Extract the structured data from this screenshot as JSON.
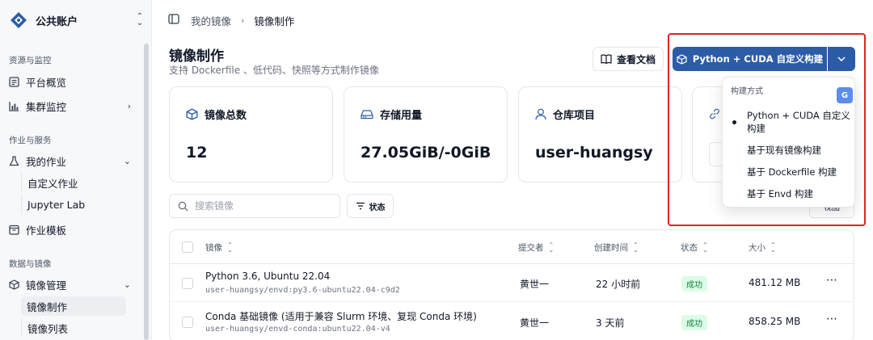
{
  "sidebar": {
    "account_name": "公共账户",
    "sections": [
      {
        "title": "资源与监控"
      },
      {
        "title": "作业与服务"
      },
      {
        "title": "数据与镜像"
      }
    ],
    "items": {
      "overview": "平台概览",
      "cluster_monitor": "集群监控",
      "my_jobs": "我的作业",
      "custom_job": "自定义作业",
      "jupyter": "Jupyter Lab",
      "job_templates": "作业模板",
      "image_mgmt": "镜像管理",
      "image_build": "镜像制作",
      "image_list": "镜像列表"
    }
  },
  "breadcrumb": {
    "parent": "我的镜像",
    "current": "镜像制作"
  },
  "header": {
    "title": "镜像制作",
    "subtitle": "支持 Dockerfile 、低代码、快照等方式制作镜像",
    "docs_button": "查看文档",
    "primary_button": "Python + CUDA 自定义构建"
  },
  "stats": [
    {
      "label": "镜像总数",
      "value": "12"
    },
    {
      "label": "存储用量",
      "value": "27.05GiB/-0GiB"
    },
    {
      "label": "仓库项目",
      "value": "user-huangsy"
    }
  ],
  "filters": {
    "search_placeholder": "搜索镜像",
    "status_button": "状态",
    "view_button": "视图"
  },
  "table": {
    "headers": {
      "image": "镜像",
      "submitter": "提交者",
      "created": "创建时间",
      "status": "状态",
      "size": "大小"
    },
    "rows": [
      {
        "name": "Python 3.6, Ubuntu 22.04",
        "path": "user-huangsy/envd:py3.6-ubuntu22.04-c9d2",
        "submitter": "黄世一",
        "created": "22 小时前",
        "status": "成功",
        "size": "481.12 MB"
      },
      {
        "name": "Conda 基础镜像 (适用于兼容 Slurm 环境、复现 Conda 环境)",
        "path": "user-huangsy/envd-conda:ubuntu22.04-v4",
        "submitter": "黄世一",
        "created": "3 天前",
        "status": "成功",
        "size": "858.25 MB"
      }
    ]
  },
  "dropdown": {
    "title": "构建方式",
    "items": [
      "Python + CUDA 自定义构建",
      "基于现有镜像构建",
      "基于 Dockerfile 构建",
      "基于 Envd 构建"
    ],
    "selected_index": 0
  },
  "colors": {
    "primary": "#2d5ca6",
    "highlight_frame": "#e02424",
    "success_bg": "#dcfce7",
    "success_text": "#15803d"
  },
  "icons": {
    "logo": "app-logo-icon",
    "translate": "google-translate-icon"
  }
}
